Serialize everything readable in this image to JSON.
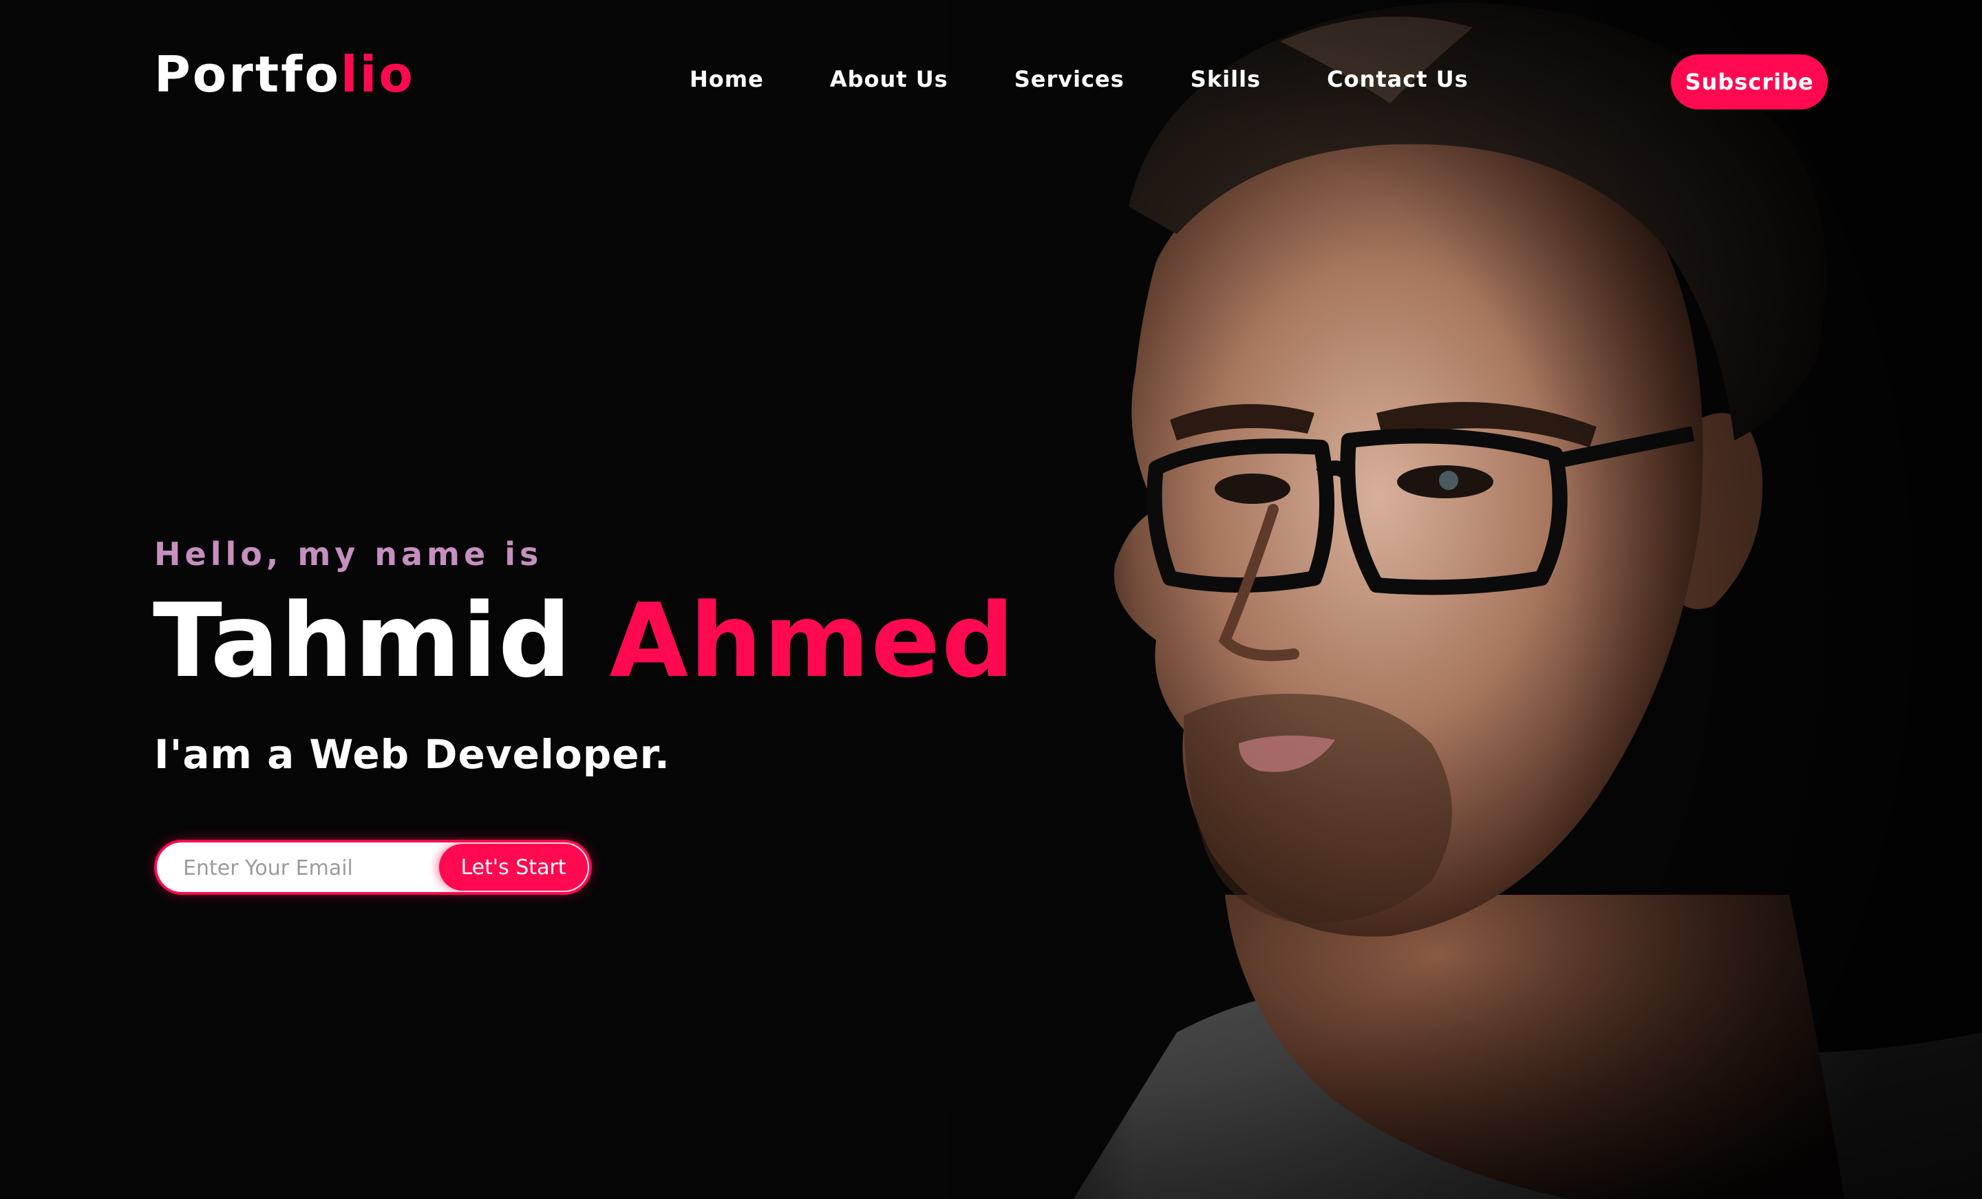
{
  "brand": {
    "main": "Portfo",
    "accent": "lio"
  },
  "nav": {
    "items": [
      "Home",
      "About Us",
      "Services",
      "Skills",
      "Contact Us"
    ]
  },
  "header": {
    "subscribe_label": "Subscribe"
  },
  "hero": {
    "greeting": "Hello, my name is",
    "first_name": "Tahmid",
    "last_name": "Ahmed",
    "role": "I'am a Web Developer.",
    "email_placeholder": "Enter Your Email",
    "cta_label": "Let's Start"
  },
  "colors": {
    "accent": "#ff0a50",
    "greeting": "#c68fbf",
    "background": "#060606",
    "text": "#ffffff"
  }
}
